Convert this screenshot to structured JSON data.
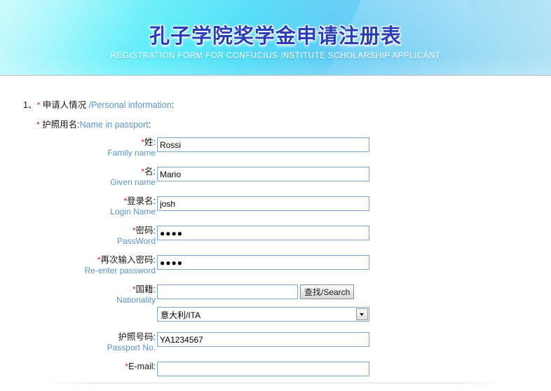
{
  "banner": {
    "title_zh": "孔子学院奖学金申请注册表",
    "subtitle_en": "REGISTRATION FORM FOR CONFUCIUS INSTITUTE SCHOLARSHIP APPLICANT",
    "gradient_left": "#63f0f9",
    "gradient_right": "#8ed7f3",
    "title_color": "#2b3fb5",
    "subtitle_color": "#ffffff"
  },
  "form": {
    "section_number": "1、",
    "section_star": "*",
    "section_zh": "申请人情况",
    "section_en": "/Personal information",
    "section_colon": ":",
    "sub_star": "*",
    "sub_zh": "护照用名",
    "sub_colon_1": ":",
    "sub_en": "Name in passport",
    "sub_colon_2": ":",
    "search_button_label": "查找/Search",
    "field_border_color": "#7ba7cc",
    "label_en_color": "#5b93c4",
    "required_star_color": "#d02020",
    "rows": [
      {
        "star": "*",
        "label_zh": "姓",
        "colon": ":",
        "label_en": "Family name",
        "type": "text",
        "value": "Rossi",
        "placeholder": ""
      },
      {
        "star": "*",
        "label_zh": "名",
        "colon": ":",
        "label_en": "Given name",
        "type": "text",
        "value": "Mario",
        "placeholder": ""
      },
      {
        "star": "*",
        "label_zh": "登录名",
        "colon": ":",
        "label_en": "Login Name",
        "type": "text",
        "value": "josh",
        "placeholder": ""
      },
      {
        "star": "*",
        "label_zh": "密码",
        "colon": ":",
        "label_en": "PassWord",
        "type": "password",
        "value": "●●●●",
        "placeholder": ""
      },
      {
        "star": "*",
        "label_zh": "再次输入密码",
        "colon": ":",
        "label_en": "Re-enter password",
        "type": "password",
        "value": "●●●●",
        "placeholder": ""
      },
      {
        "star": "*",
        "label_zh": "国籍",
        "colon": ":",
        "label_en": "Nationality",
        "type": "search",
        "value": "",
        "placeholder": ""
      },
      {
        "star": "",
        "label_zh": "护照号码",
        "colon": ":",
        "label_en": "Passport No.",
        "type": "text",
        "value": "YA1234567",
        "placeholder": ""
      },
      {
        "star": "*",
        "label_zh": "E-mail",
        "colon": ":",
        "label_en": "",
        "type": "text",
        "value": "",
        "placeholder": ""
      }
    ],
    "nationality_select": {
      "selected": "意大利/ITA",
      "arrow": "chevron-down-icon"
    }
  }
}
